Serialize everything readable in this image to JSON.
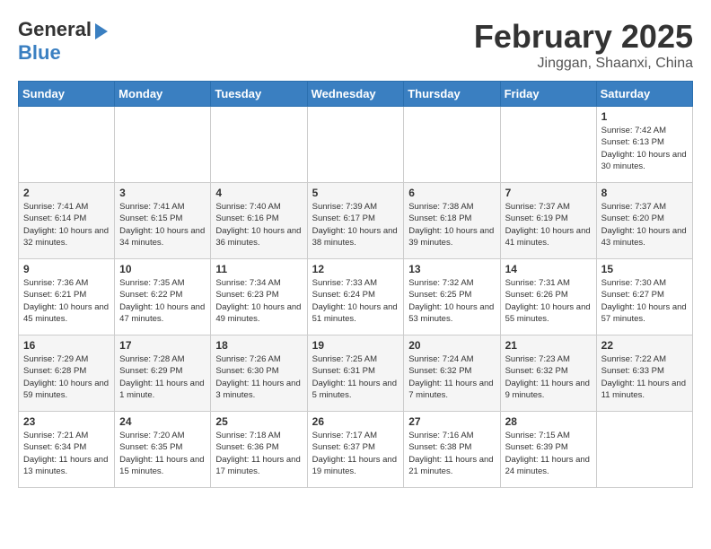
{
  "header": {
    "logo_general": "General",
    "logo_blue": "Blue",
    "month_title": "February 2025",
    "location": "Jinggan, Shaanxi, China"
  },
  "days_of_week": [
    "Sunday",
    "Monday",
    "Tuesday",
    "Wednesday",
    "Thursday",
    "Friday",
    "Saturday"
  ],
  "weeks": [
    [
      {
        "day": "",
        "info": ""
      },
      {
        "day": "",
        "info": ""
      },
      {
        "day": "",
        "info": ""
      },
      {
        "day": "",
        "info": ""
      },
      {
        "day": "",
        "info": ""
      },
      {
        "day": "",
        "info": ""
      },
      {
        "day": "1",
        "info": "Sunrise: 7:42 AM\nSunset: 6:13 PM\nDaylight: 10 hours and 30 minutes."
      }
    ],
    [
      {
        "day": "2",
        "info": "Sunrise: 7:41 AM\nSunset: 6:14 PM\nDaylight: 10 hours and 32 minutes."
      },
      {
        "day": "3",
        "info": "Sunrise: 7:41 AM\nSunset: 6:15 PM\nDaylight: 10 hours and 34 minutes."
      },
      {
        "day": "4",
        "info": "Sunrise: 7:40 AM\nSunset: 6:16 PM\nDaylight: 10 hours and 36 minutes."
      },
      {
        "day": "5",
        "info": "Sunrise: 7:39 AM\nSunset: 6:17 PM\nDaylight: 10 hours and 38 minutes."
      },
      {
        "day": "6",
        "info": "Sunrise: 7:38 AM\nSunset: 6:18 PM\nDaylight: 10 hours and 39 minutes."
      },
      {
        "day": "7",
        "info": "Sunrise: 7:37 AM\nSunset: 6:19 PM\nDaylight: 10 hours and 41 minutes."
      },
      {
        "day": "8",
        "info": "Sunrise: 7:37 AM\nSunset: 6:20 PM\nDaylight: 10 hours and 43 minutes."
      }
    ],
    [
      {
        "day": "9",
        "info": "Sunrise: 7:36 AM\nSunset: 6:21 PM\nDaylight: 10 hours and 45 minutes."
      },
      {
        "day": "10",
        "info": "Sunrise: 7:35 AM\nSunset: 6:22 PM\nDaylight: 10 hours and 47 minutes."
      },
      {
        "day": "11",
        "info": "Sunrise: 7:34 AM\nSunset: 6:23 PM\nDaylight: 10 hours and 49 minutes."
      },
      {
        "day": "12",
        "info": "Sunrise: 7:33 AM\nSunset: 6:24 PM\nDaylight: 10 hours and 51 minutes."
      },
      {
        "day": "13",
        "info": "Sunrise: 7:32 AM\nSunset: 6:25 PM\nDaylight: 10 hours and 53 minutes."
      },
      {
        "day": "14",
        "info": "Sunrise: 7:31 AM\nSunset: 6:26 PM\nDaylight: 10 hours and 55 minutes."
      },
      {
        "day": "15",
        "info": "Sunrise: 7:30 AM\nSunset: 6:27 PM\nDaylight: 10 hours and 57 minutes."
      }
    ],
    [
      {
        "day": "16",
        "info": "Sunrise: 7:29 AM\nSunset: 6:28 PM\nDaylight: 10 hours and 59 minutes."
      },
      {
        "day": "17",
        "info": "Sunrise: 7:28 AM\nSunset: 6:29 PM\nDaylight: 11 hours and 1 minute."
      },
      {
        "day": "18",
        "info": "Sunrise: 7:26 AM\nSunset: 6:30 PM\nDaylight: 11 hours and 3 minutes."
      },
      {
        "day": "19",
        "info": "Sunrise: 7:25 AM\nSunset: 6:31 PM\nDaylight: 11 hours and 5 minutes."
      },
      {
        "day": "20",
        "info": "Sunrise: 7:24 AM\nSunset: 6:32 PM\nDaylight: 11 hours and 7 minutes."
      },
      {
        "day": "21",
        "info": "Sunrise: 7:23 AM\nSunset: 6:32 PM\nDaylight: 11 hours and 9 minutes."
      },
      {
        "day": "22",
        "info": "Sunrise: 7:22 AM\nSunset: 6:33 PM\nDaylight: 11 hours and 11 minutes."
      }
    ],
    [
      {
        "day": "23",
        "info": "Sunrise: 7:21 AM\nSunset: 6:34 PM\nDaylight: 11 hours and 13 minutes."
      },
      {
        "day": "24",
        "info": "Sunrise: 7:20 AM\nSunset: 6:35 PM\nDaylight: 11 hours and 15 minutes."
      },
      {
        "day": "25",
        "info": "Sunrise: 7:18 AM\nSunset: 6:36 PM\nDaylight: 11 hours and 17 minutes."
      },
      {
        "day": "26",
        "info": "Sunrise: 7:17 AM\nSunset: 6:37 PM\nDaylight: 11 hours and 19 minutes."
      },
      {
        "day": "27",
        "info": "Sunrise: 7:16 AM\nSunset: 6:38 PM\nDaylight: 11 hours and 21 minutes."
      },
      {
        "day": "28",
        "info": "Sunrise: 7:15 AM\nSunset: 6:39 PM\nDaylight: 11 hours and 24 minutes."
      },
      {
        "day": "",
        "info": ""
      }
    ]
  ]
}
